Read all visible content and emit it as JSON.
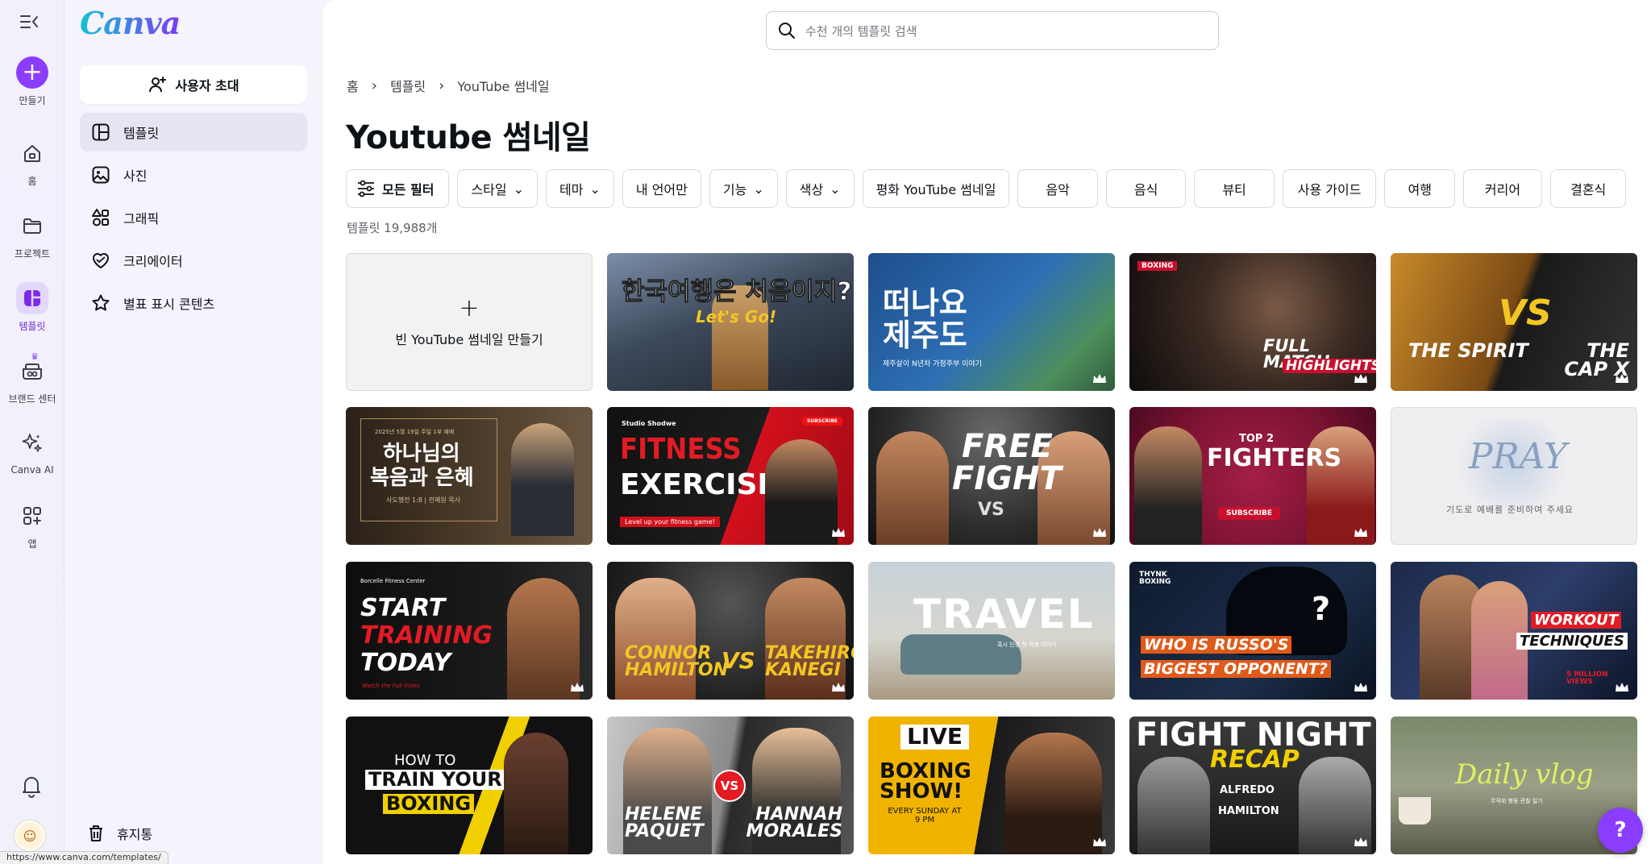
{
  "app": {
    "logo": "Canva"
  },
  "rail": {
    "create": "만들기",
    "home": "홈",
    "projects": "프로젝트",
    "templates": "템플릿",
    "brand": "브랜드 센터",
    "ai": "Canva AI",
    "apps": "앱"
  },
  "sidebar": {
    "invite": "사용자 초대",
    "items": [
      {
        "label": "템플릿",
        "icon": "template-icon"
      },
      {
        "label": "사진",
        "icon": "photo-icon"
      },
      {
        "label": "그래픽",
        "icon": "graphics-icon"
      },
      {
        "label": "크리에이터",
        "icon": "creator-heart-icon"
      },
      {
        "label": "별표 표시 콘텐츠",
        "icon": "star-icon"
      }
    ],
    "trash": "휴지통"
  },
  "search": {
    "placeholder": "수천 개의 템플릿 검색"
  },
  "breadcrumb": {
    "home": "홈",
    "templates": "템플릿",
    "current": "YouTube 썸네일"
  },
  "page": {
    "title": "Youtube 썸네일",
    "count": "템플릿 19,988개"
  },
  "filters": {
    "all": "모든 필터",
    "style": "스타일",
    "theme": "테마",
    "language": "내 언어만",
    "feature": "기능",
    "color": "색상",
    "tags": [
      "평화 YouTube 썸네일",
      "음악",
      "음식",
      "뷰티",
      "사용 가이드",
      "여행",
      "커리어",
      "결혼식"
    ]
  },
  "blank": {
    "label": "빈 YouTube 썸네일 만들기"
  },
  "thumbs": {
    "t1": {
      "l1": "한국여행은 처음이지?",
      "l2": "Let's Go!"
    },
    "t2": {
      "l1": "떠나요",
      "l2": "제주도",
      "sub": "제주살이 N년차 가정주부 이야기"
    },
    "t3": {
      "tag": "BOXING",
      "l1": "FULL MATCH",
      "l2": "HIGHLIGHTS"
    },
    "t4": {
      "left": "THE SPIRIT",
      "vs": "VS",
      "right": "THE CAP X"
    },
    "t5": {
      "top": "2025년 5월 19일 주일 1부 예배",
      "l1": "하나님의",
      "l2": "복음과 은혜",
      "sub": "사도행전 1:8 | 전혜원 목사"
    },
    "t6": {
      "brand": "Studio Shodwe",
      "l1": "FITNESS",
      "l2": "EXERCISE",
      "sub": "Level up your fitness game!",
      "btn": "SUBSCRIBE"
    },
    "t7": {
      "l1": "FREE",
      "l2": "FIGHT",
      "vs": "VS"
    },
    "t8": {
      "top": "TOP 2",
      "l1": "FIGHTERS",
      "btn": "SUBSCRIBE"
    },
    "t9": {
      "l1": "PRAY",
      "sub": "기도로 예배를 준비하여 주세요"
    },
    "t10": {
      "brand": "Borcelle Fitness Center",
      "l1": "START",
      "l2": "TRAINING",
      "l3": "TODAY",
      "sub": "Watch the Full Video"
    },
    "t11": {
      "left": "CONNOR HAMILTON",
      "vs": "VS",
      "right": "TAKEHIRO KANEGI"
    },
    "t12": {
      "l1": "TRAVEL",
      "sub": "혹시 인생 첫 여행 이야기"
    },
    "t13": {
      "brand": "THYNK BOXING",
      "l1": "WHO IS RUSSO'S",
      "l2": "BIGGEST OPPONENT?"
    },
    "t14": {
      "l1": "WORKOUT",
      "l2": "TECHNIQUES",
      "sub": "5 MILLION VIEWS"
    },
    "t15": {
      "l1": "HOW TO",
      "l2": "TRAIN YOUR",
      "l3": "BOXING"
    },
    "t16": {
      "left": "HELENE PAQUET",
      "vs": "VS",
      "right": "HANNAH MORALES"
    },
    "t17": {
      "l1": "LIVE",
      "l2": "BOXING SHOW!",
      "sub": "EVERY SUNDAY AT 9 PM"
    },
    "t18": {
      "l1": "FIGHT NIGHT",
      "l2": "RECAP",
      "l3": "ALFREDO",
      "l4": "HAMILTON"
    },
    "t19": {
      "l1": "Daily vlog",
      "sub": "무작위 행동 관찰 일기"
    }
  },
  "status": {
    "url": "https://www.canva.com/templates/"
  },
  "help": {
    "label": "?"
  },
  "colors": {
    "brand": "#8b3dff",
    "accent": "#20b6cf"
  }
}
